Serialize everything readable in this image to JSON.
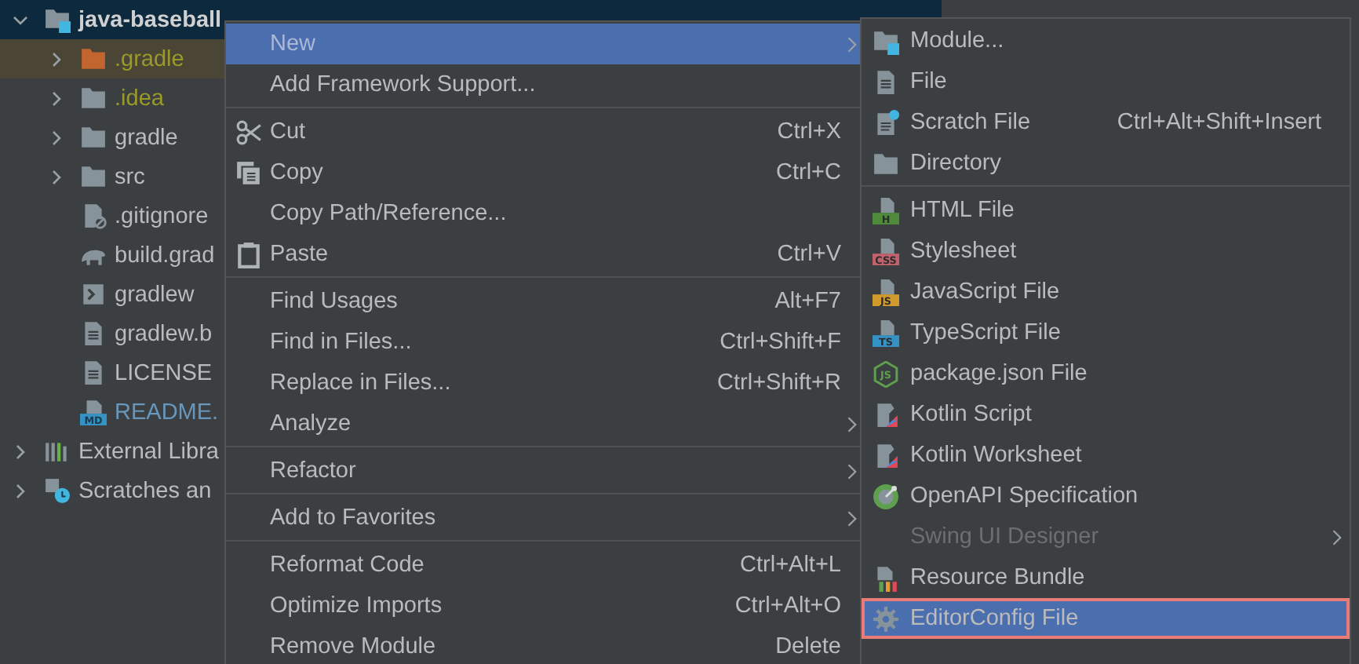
{
  "project_tree": [
    {
      "label": "java-baseball",
      "kind": "module",
      "expanded": true,
      "selected": true,
      "highlighted": false,
      "color": "#d0d0d0",
      "children": [
        {
          "label": ".gradle",
          "kind": "folder-excluded",
          "expanded": false,
          "selected": false,
          "highlighted": true,
          "color": "#9a9a2a"
        },
        {
          "label": ".idea",
          "kind": "folder",
          "expanded": false,
          "selected": false,
          "highlighted": false,
          "color": "#9a9a2a"
        },
        {
          "label": "gradle",
          "kind": "folder",
          "expanded": false,
          "selected": false,
          "highlighted": false,
          "color": "#bbbbbb"
        },
        {
          "label": "src",
          "kind": "folder",
          "expanded": false,
          "selected": false,
          "highlighted": false,
          "color": "#bbbbbb"
        },
        {
          "label": ".gitignore",
          "kind": "ignore-file",
          "selected": false,
          "highlighted": false,
          "color": "#bbbbbb"
        },
        {
          "label": "build.grad",
          "kind": "elephant",
          "selected": false,
          "highlighted": false,
          "color": "#bbbbbb"
        },
        {
          "label": "gradlew",
          "kind": "terminal",
          "selected": false,
          "highlighted": false,
          "color": "#bbbbbb"
        },
        {
          "label": "gradlew.b",
          "kind": "text-file",
          "selected": false,
          "highlighted": false,
          "color": "#bbbbbb"
        },
        {
          "label": "LICENSE",
          "kind": "text-file",
          "selected": false,
          "highlighted": false,
          "color": "#bbbbbb"
        },
        {
          "label": "README.",
          "kind": "markdown",
          "badge": "MD",
          "selected": false,
          "highlighted": false,
          "color": "#6897bb"
        }
      ]
    },
    {
      "label": "External Libra",
      "kind": "library",
      "expanded": false,
      "selected": false,
      "highlighted": false,
      "color": "#bbbbbb"
    },
    {
      "label": "Scratches an",
      "kind": "scratches",
      "expanded": false,
      "selected": false,
      "highlighted": false,
      "color": "#bbbbbb"
    }
  ],
  "context_menu": {
    "sections": [
      [
        {
          "label": "New",
          "kind": "plain",
          "submenu": true,
          "selected": true
        },
        {
          "label": "Add Framework Support...",
          "kind": "plain",
          "submenu": false,
          "selected": false
        }
      ],
      [
        {
          "label": "Cut",
          "kind": "scissors",
          "shortcut": "Ctrl+X",
          "submenu": false,
          "selected": false
        },
        {
          "label": "Copy",
          "kind": "copy",
          "shortcut": "Ctrl+C",
          "submenu": false,
          "selected": false
        },
        {
          "label": "Copy Path/Reference...",
          "kind": "plain",
          "submenu": false,
          "selected": false
        },
        {
          "label": "Paste",
          "kind": "paste",
          "shortcut": "Ctrl+V",
          "submenu": false,
          "selected": false
        }
      ],
      [
        {
          "label": "Find Usages",
          "kind": "plain",
          "shortcut": "Alt+F7",
          "submenu": false,
          "selected": false
        },
        {
          "label": "Find in Files...",
          "kind": "plain",
          "shortcut": "Ctrl+Shift+F",
          "submenu": false,
          "selected": false
        },
        {
          "label": "Replace in Files...",
          "kind": "plain",
          "shortcut": "Ctrl+Shift+R",
          "submenu": false,
          "selected": false
        },
        {
          "label": "Analyze",
          "kind": "plain",
          "submenu": true,
          "selected": false
        }
      ],
      [
        {
          "label": "Refactor",
          "kind": "plain",
          "submenu": true,
          "selected": false
        }
      ],
      [
        {
          "label": "Add to Favorites",
          "kind": "plain",
          "submenu": true,
          "selected": false
        }
      ],
      [
        {
          "label": "Reformat Code",
          "kind": "plain",
          "shortcut": "Ctrl+Alt+L",
          "submenu": false,
          "selected": false
        },
        {
          "label": "Optimize Imports",
          "kind": "plain",
          "shortcut": "Ctrl+Alt+O",
          "submenu": false,
          "selected": false
        },
        {
          "label": "Remove Module",
          "kind": "plain",
          "shortcut": "Delete",
          "submenu": false,
          "selected": false
        }
      ]
    ]
  },
  "new_submenu": {
    "sections": [
      [
        {
          "label": "Module...",
          "kind": "module",
          "submenu": false,
          "selected": false,
          "disabled": false,
          "annotated": false
        },
        {
          "label": "File",
          "kind": "text-file",
          "submenu": false,
          "selected": false,
          "disabled": false,
          "annotated": false
        },
        {
          "label": "Scratch File",
          "kind": "scratch",
          "shortcut": "Ctrl+Alt+Shift+Insert",
          "submenu": false,
          "selected": false,
          "disabled": false,
          "annotated": false
        },
        {
          "label": "Directory",
          "kind": "folder",
          "submenu": false,
          "selected": false,
          "disabled": false,
          "annotated": false
        }
      ],
      [
        {
          "label": "HTML File",
          "kind": "html",
          "badge": "H",
          "submenu": false,
          "selected": false,
          "disabled": false,
          "annotated": false
        },
        {
          "label": "Stylesheet",
          "kind": "css",
          "badge": "CSS",
          "submenu": false,
          "selected": false,
          "disabled": false,
          "annotated": false
        },
        {
          "label": "JavaScript File",
          "kind": "js",
          "badge": "JS",
          "submenu": false,
          "selected": false,
          "disabled": false,
          "annotated": false
        },
        {
          "label": "TypeScript File",
          "kind": "ts",
          "badge": "TS",
          "submenu": false,
          "selected": false,
          "disabled": false,
          "annotated": false
        },
        {
          "label": "package.json File",
          "kind": "node",
          "badge": "JS",
          "submenu": false,
          "selected": false,
          "disabled": false,
          "annotated": false
        },
        {
          "label": "Kotlin Script",
          "kind": "kotlin",
          "submenu": false,
          "selected": false,
          "disabled": false,
          "annotated": false
        },
        {
          "label": "Kotlin Worksheet",
          "kind": "kotlin",
          "submenu": false,
          "selected": false,
          "disabled": false,
          "annotated": false
        },
        {
          "label": "OpenAPI Specification",
          "kind": "openapi",
          "submenu": false,
          "selected": false,
          "disabled": false,
          "annotated": false
        },
        {
          "label": "Swing UI Designer",
          "kind": "plain",
          "submenu": true,
          "selected": false,
          "disabled": true,
          "annotated": false
        },
        {
          "label": "Resource Bundle",
          "kind": "bundle",
          "submenu": false,
          "selected": false,
          "disabled": false,
          "annotated": false
        },
        {
          "label": "EditorConfig File",
          "kind": "gear",
          "submenu": false,
          "selected": true,
          "disabled": false,
          "annotated": true
        }
      ]
    ]
  }
}
